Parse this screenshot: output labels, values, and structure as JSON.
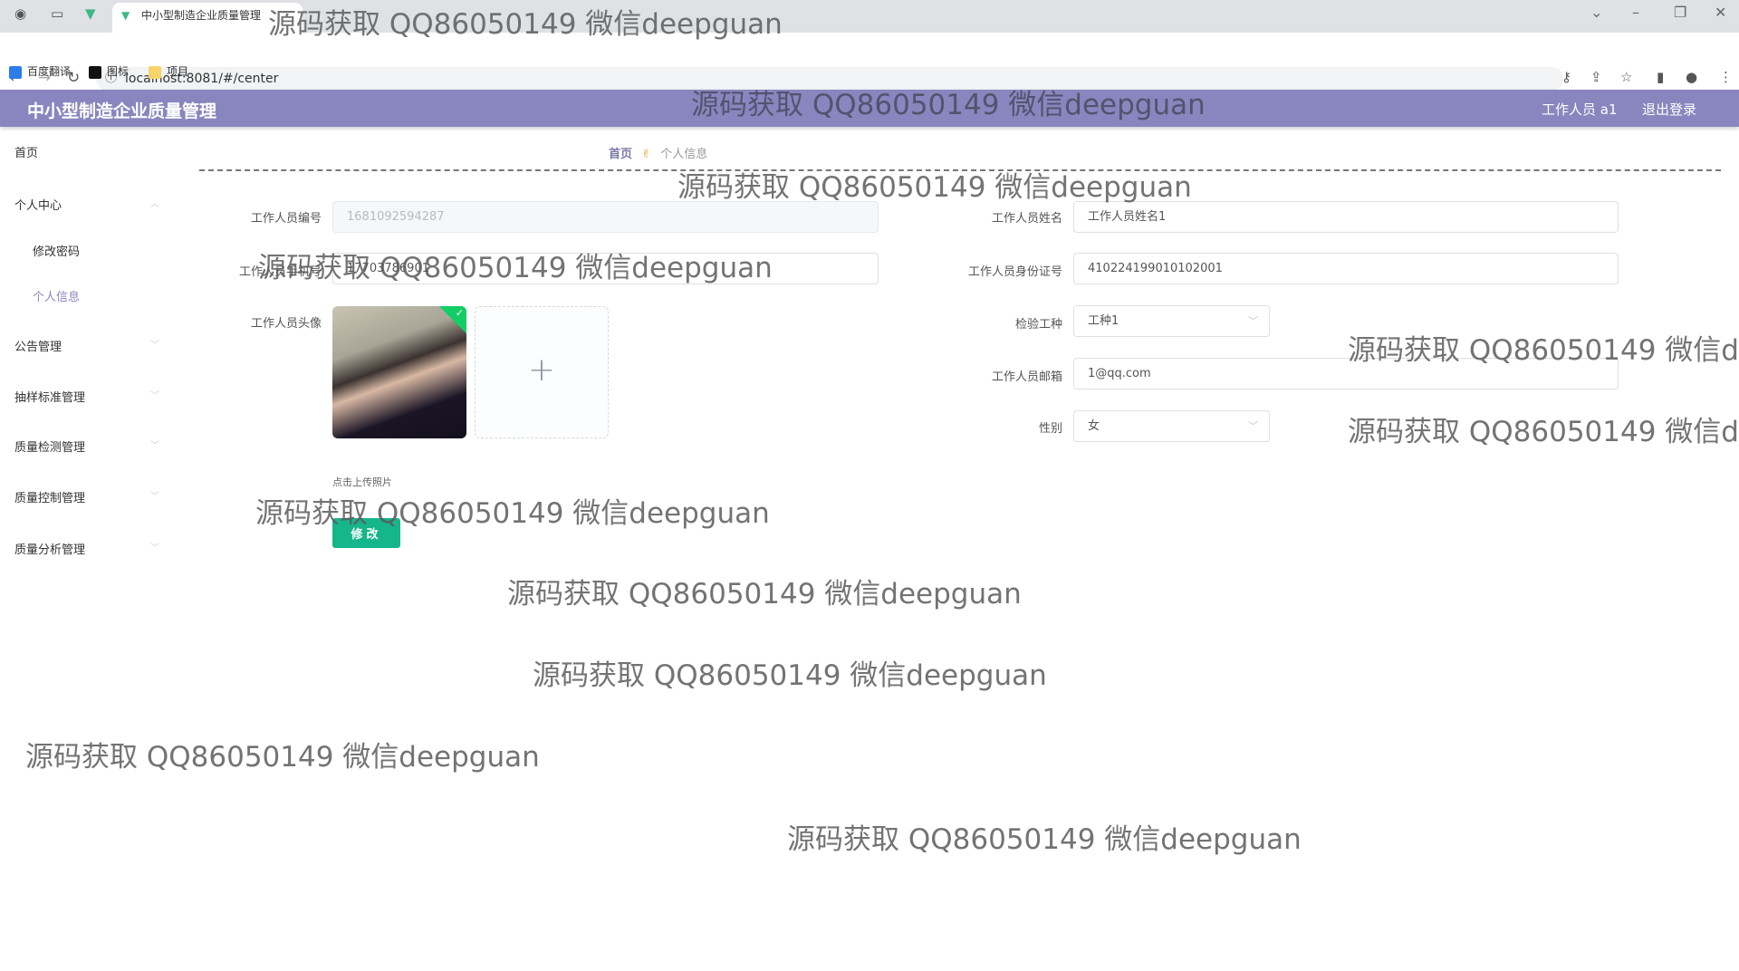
{
  "browser": {
    "tab_title": "中小型制造企业质量管理",
    "url": "localhost:8081/#/center",
    "bookmarks": [
      "百度翻译",
      "图标",
      "项目"
    ]
  },
  "header": {
    "title": "中小型制造企业质量管理",
    "user": "工作人员 a1",
    "logout": "退出登录",
    "color": "#8986bf"
  },
  "sidebar": {
    "items": [
      {
        "label": "首页"
      },
      {
        "label": "个人中心"
      },
      {
        "label": "修改密码"
      },
      {
        "label": "个人信息"
      },
      {
        "label": "公告管理"
      },
      {
        "label": "抽样标准管理"
      },
      {
        "label": "质量检测管理"
      },
      {
        "label": "质量控制管理"
      },
      {
        "label": "质量分析管理"
      }
    ]
  },
  "breadcrumb": {
    "home": "首页",
    "current": "个人信息"
  },
  "form": {
    "id_label": "工作人员编号",
    "id_value": "1681092594287",
    "phone_label": "工作人员手机号",
    "phone_value": "17703786901",
    "avatar_label": "工作人员头像",
    "upload_tip": "点击上传照片",
    "name_label": "工作人员姓名",
    "name_value": "工作人员姓名1",
    "idcard_label": "工作人员身份证号",
    "idcard_value": "410224199010102001",
    "type_label": "检验工种",
    "type_value": "工种1",
    "email_label": "工作人员邮箱",
    "email_value": "1@qq.com",
    "gender_label": "性别",
    "gender_value": "女",
    "submit": "修改",
    "submit_color": "#16b68b"
  },
  "watermark": "源码获取 QQ86050149 微信deepguan"
}
